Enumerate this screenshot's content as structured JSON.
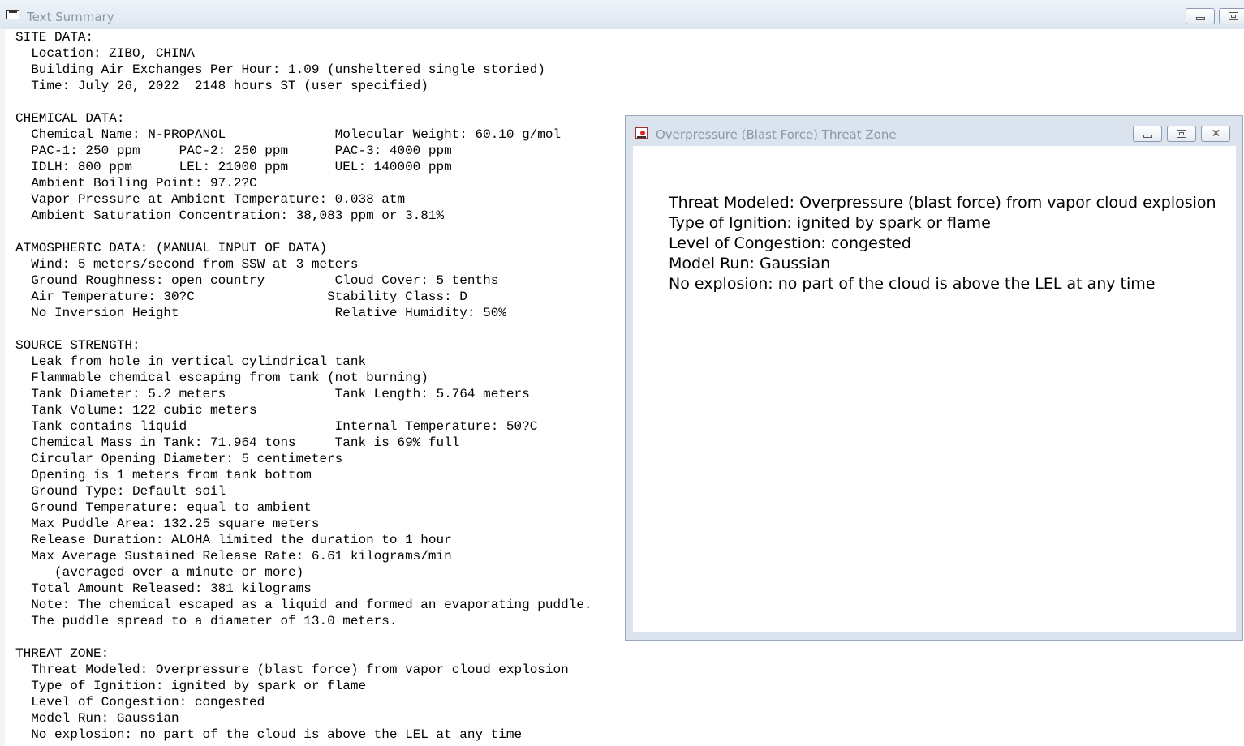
{
  "main_window": {
    "title": "Text Summary",
    "summary_lines": [
      "SITE DATA:",
      "  Location: ZIBO, CHINA",
      "  Building Air Exchanges Per Hour: 1.09 (unsheltered single storied)",
      "  Time: July 26, 2022  2148 hours ST (user specified)",
      "",
      "CHEMICAL DATA:",
      "  Chemical Name: N-PROPANOL              Molecular Weight: 60.10 g/mol",
      "  PAC-1: 250 ppm     PAC-2: 250 ppm      PAC-3: 4000 ppm",
      "  IDLH: 800 ppm      LEL: 21000 ppm      UEL: 140000 ppm",
      "  Ambient Boiling Point: 97.2?C",
      "  Vapor Pressure at Ambient Temperature: 0.038 atm",
      "  Ambient Saturation Concentration: 38,083 ppm or 3.81%",
      "",
      "ATMOSPHERIC DATA: (MANUAL INPUT OF DATA)",
      "  Wind: 5 meters/second from SSW at 3 meters",
      "  Ground Roughness: open country         Cloud Cover: 5 tenths",
      "  Air Temperature: 30?C                 Stability Class: D",
      "  No Inversion Height                    Relative Humidity: 50%",
      "",
      "SOURCE STRENGTH:",
      "  Leak from hole in vertical cylindrical tank",
      "  Flammable chemical escaping from tank (not burning)",
      "  Tank Diameter: 5.2 meters              Tank Length: 5.764 meters",
      "  Tank Volume: 122 cubic meters",
      "  Tank contains liquid                   Internal Temperature: 50?C",
      "  Chemical Mass in Tank: 71.964 tons     Tank is 69% full",
      "  Circular Opening Diameter: 5 centimeters",
      "  Opening is 1 meters from tank bottom",
      "  Ground Type: Default soil",
      "  Ground Temperature: equal to ambient",
      "  Max Puddle Area: 132.25 square meters",
      "  Release Duration: ALOHA limited the duration to 1 hour",
      "  Max Average Sustained Release Rate: 6.61 kilograms/min",
      "     (averaged over a minute or more)",
      "  Total Amount Released: 381 kilograms",
      "  Note: The chemical escaped as a liquid and formed an evaporating puddle.",
      "  The puddle spread to a diameter of 13.0 meters.",
      "",
      "THREAT ZONE:",
      "  Threat Modeled: Overpressure (blast force) from vapor cloud explosion",
      "  Type of Ignition: ignited by spark or flame",
      "  Level of Congestion: congested",
      "  Model Run: Gaussian",
      "  No explosion: no part of the cloud is above the LEL at any time"
    ]
  },
  "threat_window": {
    "title": "Overpressure (Blast Force) Threat Zone",
    "lines": [
      "Threat Modeled: Overpressure (blast force) from vapor cloud explosion",
      "Type of Ignition: ignited by spark or flame",
      "Level of Congestion: congested",
      "Model Run: Gaussian",
      "No explosion: no part of the cloud is above the LEL at any time"
    ]
  },
  "icons": {
    "main_app": "document-window-icon",
    "threat_app": "threat-zone-chart-icon",
    "minimize": "minimize-icon",
    "maximize": "maximize-icon",
    "close": "close-icon"
  }
}
